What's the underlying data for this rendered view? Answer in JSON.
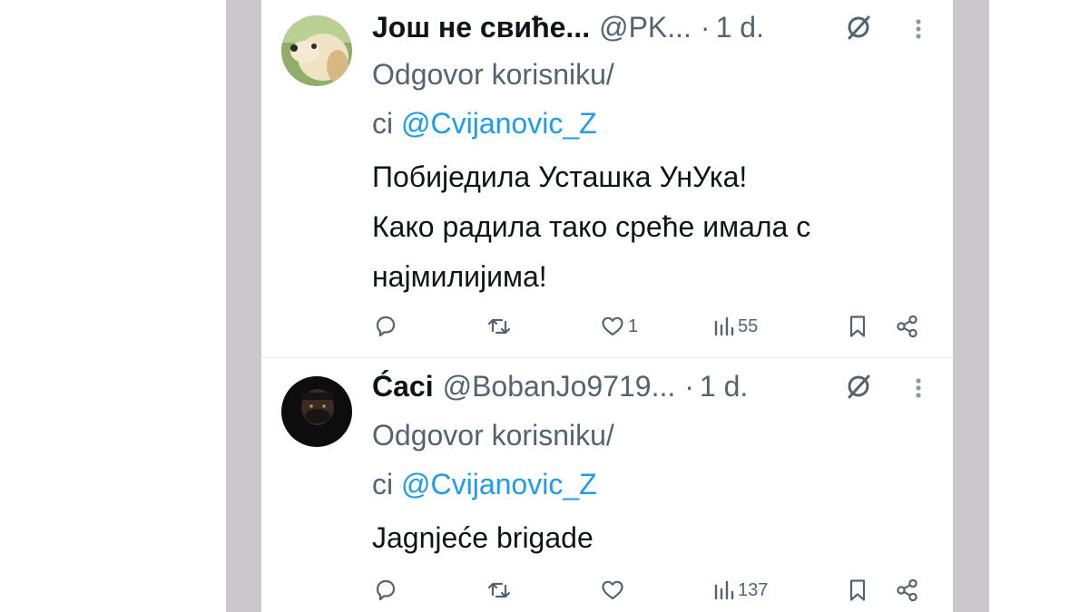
{
  "tweets": [
    {
      "name": "Још не свиће...",
      "handle": "@PK...",
      "dot": "·",
      "time": "1 d.",
      "reply_prefix": "Odgovor korisniku/",
      "reply_ci": "ci",
      "reply_mention": "@Cvijanovic_Z",
      "body": [
        "Побиједила Усташка УнУка!",
        "Како радила тако среће имала с",
        "најмилијима!"
      ],
      "counts": {
        "replies": "",
        "retweets": "",
        "likes": "1",
        "views": "55"
      },
      "avatar": "puppy"
    },
    {
      "name": "Ćaci",
      "handle": "@BobanJo9719...",
      "dot": "·",
      "time": "1 d.",
      "reply_prefix": "Odgovor korisniku/",
      "reply_ci": "ci",
      "reply_mention": "@Cvijanovic_Z",
      "body": [
        "Jagnjeće brigade"
      ],
      "counts": {
        "replies": "",
        "retweets": "",
        "likes": "",
        "views": "137"
      },
      "avatar": "dark-figure"
    }
  ],
  "icons": [
    "reply-icon",
    "retweet-icon",
    "like-icon",
    "views-icon",
    "bookmark-icon",
    "share-icon",
    "grok-icon",
    "more-icon"
  ],
  "colors": {
    "text": "#0f1419",
    "secondary": "#536471",
    "link": "#1d9bf0",
    "gutter": "#cbc8cb"
  }
}
